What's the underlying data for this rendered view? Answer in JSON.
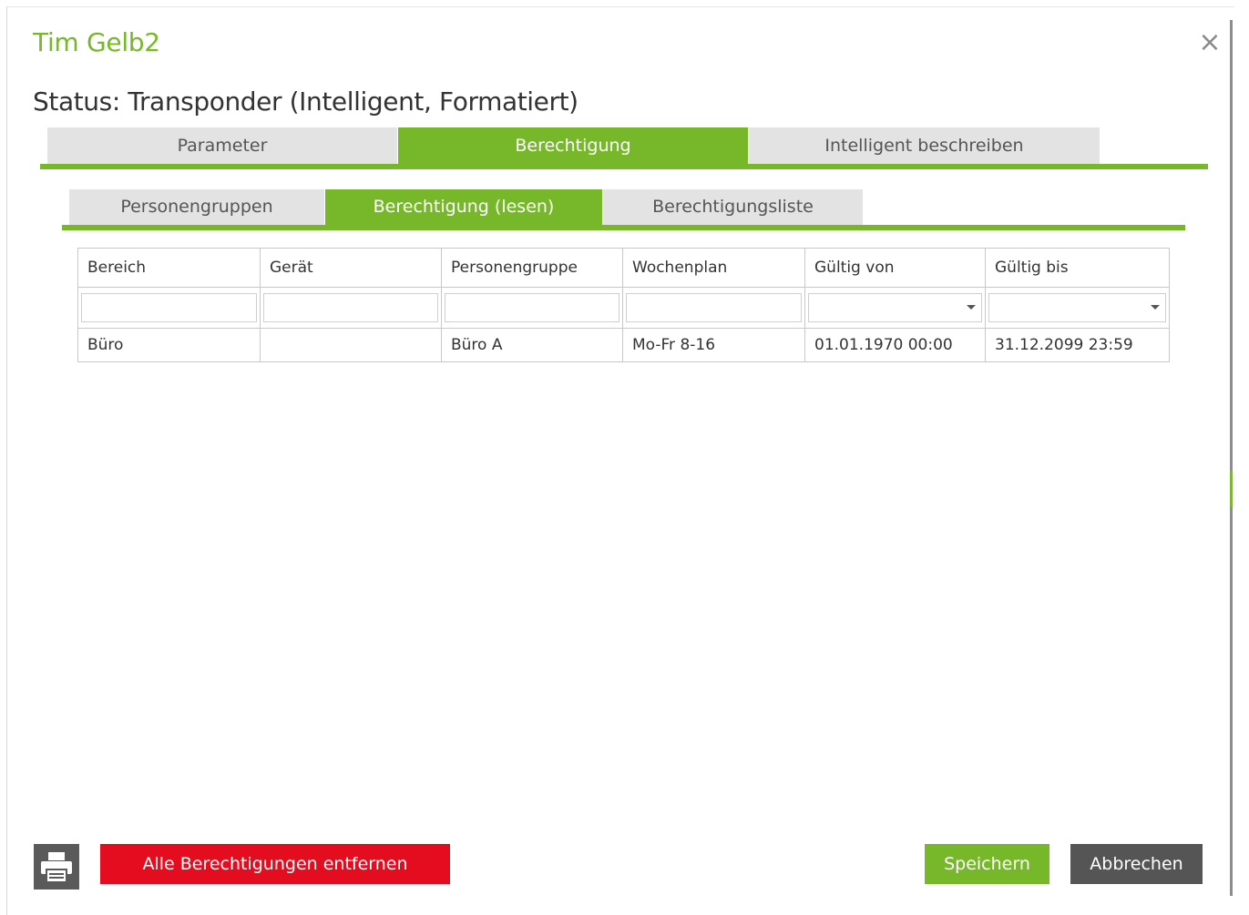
{
  "dialog": {
    "title": "Tim Gelb2",
    "close_label": "×",
    "status": "Status: Transponder (Intelligent, Formatiert)"
  },
  "main_tabs": [
    {
      "label": "Parameter",
      "active": false
    },
    {
      "label": "Berechtigung",
      "active": true
    },
    {
      "label": "Intelligent beschreiben",
      "active": false
    }
  ],
  "sub_tabs": [
    {
      "label": "Personengruppen",
      "active": false
    },
    {
      "label": "Berechtigung (lesen)",
      "active": true
    },
    {
      "label": "Berechtigungsliste",
      "active": false
    }
  ],
  "grid": {
    "columns": [
      "Bereich",
      "Gerät",
      "Personengruppe",
      "Wochenplan",
      "Gültig von",
      "Gültig bis"
    ],
    "rows": [
      [
        "Büro",
        "",
        "Büro A",
        "Mo-Fr 8-16",
        "01.01.1970 00:00",
        "31.12.2099 23:59"
      ]
    ]
  },
  "footer": {
    "print_icon": "printer-icon",
    "remove_all_label": "Alle Berechtigungen entfernen",
    "save_label": "Speichern",
    "cancel_label": "Abbrechen"
  },
  "colors": {
    "accent": "#76b82a",
    "danger": "#e30d1f",
    "neutral_button": "#555555",
    "tab_inactive": "#e3e3e3"
  }
}
